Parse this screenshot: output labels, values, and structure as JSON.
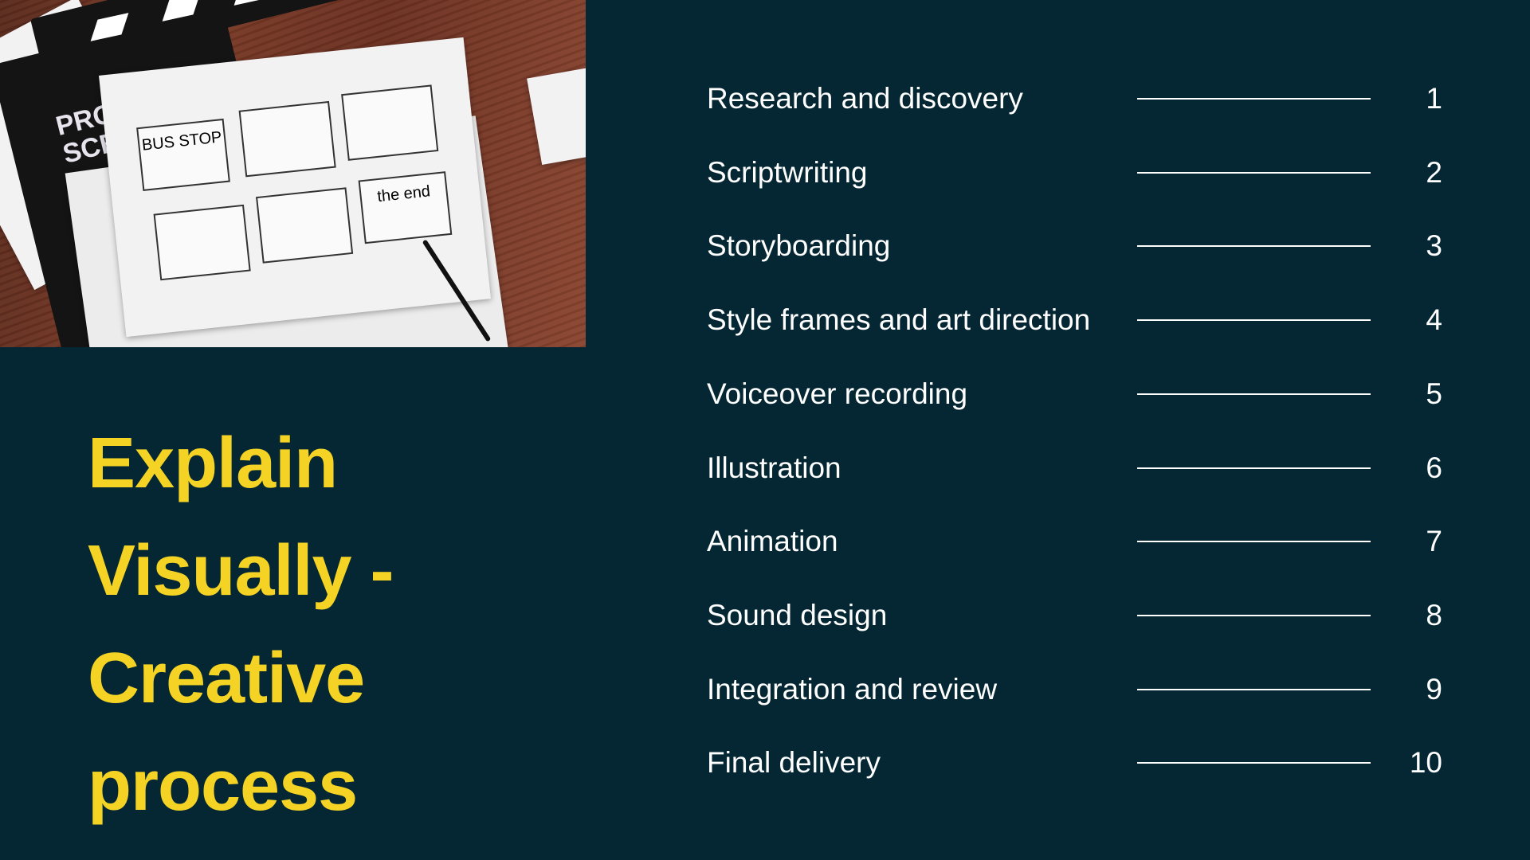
{
  "slide": {
    "title": "Explain Visually - Creative process",
    "photo_text": {
      "clapboard": "PROD SCENE",
      "frames": [
        "BUS STOP",
        "the end"
      ]
    },
    "colors": {
      "background": "#042733",
      "title": "#f4d324",
      "text": "#ffffff"
    },
    "items": [
      {
        "label": "Research and discovery",
        "number": "1"
      },
      {
        "label": "Scriptwriting",
        "number": "2"
      },
      {
        "label": "Storyboarding",
        "number": "3"
      },
      {
        "label": "Style frames and art direction",
        "number": "4"
      },
      {
        "label": "Voiceover recording",
        "number": "5"
      },
      {
        "label": "Illustration",
        "number": "6"
      },
      {
        "label": "Animation",
        "number": "7"
      },
      {
        "label": "Sound design",
        "number": "8"
      },
      {
        "label": "Integration and review",
        "number": "9"
      },
      {
        "label": "Final delivery",
        "number": "10"
      }
    ]
  }
}
